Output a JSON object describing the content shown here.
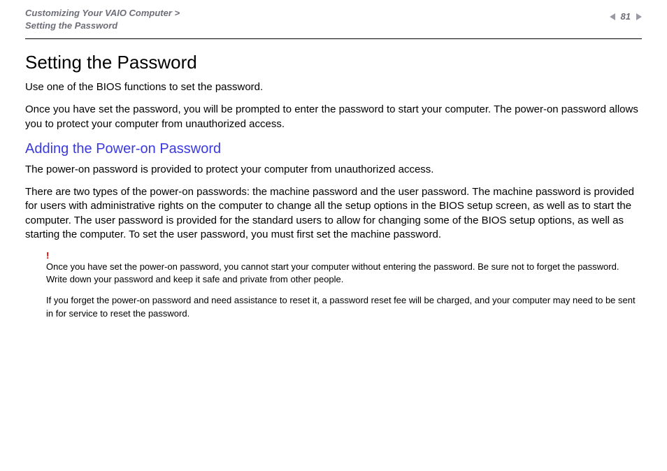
{
  "header": {
    "breadcrumb_line1": "Customizing Your VAIO Computer >",
    "breadcrumb_line2": "Setting the Password",
    "page_number": "81"
  },
  "content": {
    "h1": "Setting the Password",
    "p1": "Use one of the BIOS functions to set the password.",
    "p2": "Once you have set the password, you will be prompted to enter the password to start your computer. The power-on password allows you to protect your computer from unauthorized access.",
    "h2": "Adding the Power-on Password",
    "p3": "The power-on password is provided to protect your computer from unauthorized access.",
    "p4": "There are two types of the power-on passwords: the machine password and the user password. The machine password is provided for users with administrative rights on the computer to change all the setup options in the BIOS setup screen, as well as to start the computer. The user password is provided for the standard users to allow for changing some of the BIOS setup options, as well as starting the computer. To set the user password, you must first set the machine password."
  },
  "note": {
    "mark": "!",
    "text1": "Once you have set the power-on password, you cannot start your computer without entering the password. Be sure not to forget the password. Write down your password and keep it safe and private from other people.",
    "text2": "If you forget the power-on password and need assistance to reset it, a password reset fee will be charged, and your computer may need to be sent in for service to reset the password."
  }
}
